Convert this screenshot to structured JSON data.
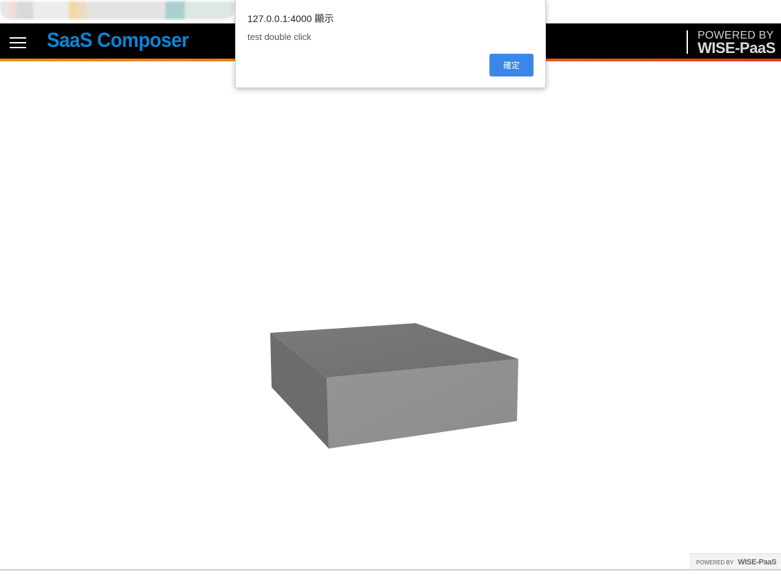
{
  "appbar": {
    "brand": "SaaS Composer",
    "powered_top": "POWERED BY",
    "powered_bottom": "WISE-PaaS",
    "menu_icon": "hamburger-menu-icon"
  },
  "dialog": {
    "title": "127.0.0.1:4000 顯示",
    "message": "test double click",
    "ok_label": "確定"
  },
  "footer": {
    "powered_small": "POWERED BY",
    "brand_small": "WISE-PaaS"
  },
  "colors": {
    "brand_blue": "#0b86d6",
    "appbar_bg": "#000000",
    "stripe_orange": "#f08c14",
    "stripe_red": "#e8361c",
    "button_blue": "#3b87e8",
    "box_top": "#727272",
    "box_front": "#919191",
    "box_side": "#6a6a6a"
  }
}
